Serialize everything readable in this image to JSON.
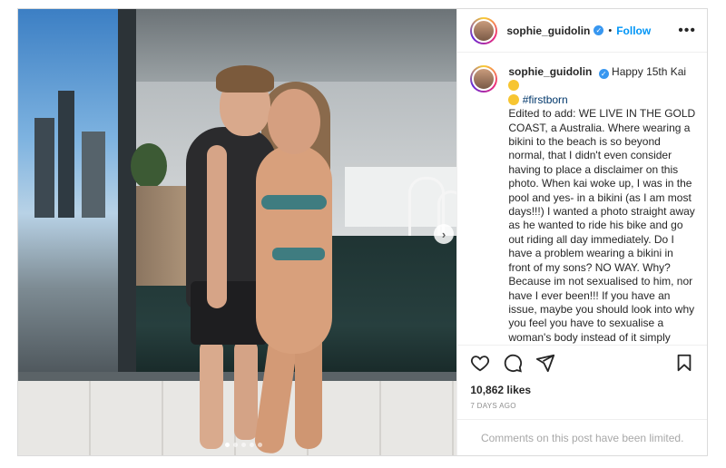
{
  "post": {
    "username": "sophie_guidolin",
    "follow_label": "Follow",
    "separator": "•",
    "more_label": "•••",
    "caption": {
      "username": "sophie_guidolin",
      "intro": "Happy 15th Kai",
      "hashtag": "#firstborn",
      "body": "Edited to add: WE LIVE IN THE GOLD COAST, a Australia. Where wearing a bikini to the beach is so beyond normal, that I didn't even consider having to place a disclaimer on this photo. When kai woke up, I was in the pool and yes- in a bikini (as I am most days!!!) I wanted a photo straight away as he wanted to ride his bike and go out riding all day immediately. Do I have a problem wearing a bikini in front of my sons? NO WAY. Why? Because im not sexualised to him, nor have I ever been!!! If you have an issue, maybe you should look into why you feel you have to sexualise a woman's body instead of it simply being a mum and her son at the pool!!!"
    },
    "likes": "10,862 likes",
    "date": "7 DAYS AGO",
    "comments_limited": "Comments on this post have been limited.",
    "carousel": {
      "total": 5,
      "active_index": 0,
      "next_label": "›"
    }
  },
  "icons": {
    "verified": "verified-badge-icon",
    "like": "heart-icon",
    "comment": "comment-icon",
    "share": "paper-plane-icon",
    "save": "bookmark-icon",
    "next": "chevron-right-icon",
    "emoji": "star-struck-emoji-icon"
  },
  "colors": {
    "follow": "#0095f6",
    "verified": "#3897f0",
    "hashtag": "#00376b",
    "muted": "#8e8e8e"
  }
}
